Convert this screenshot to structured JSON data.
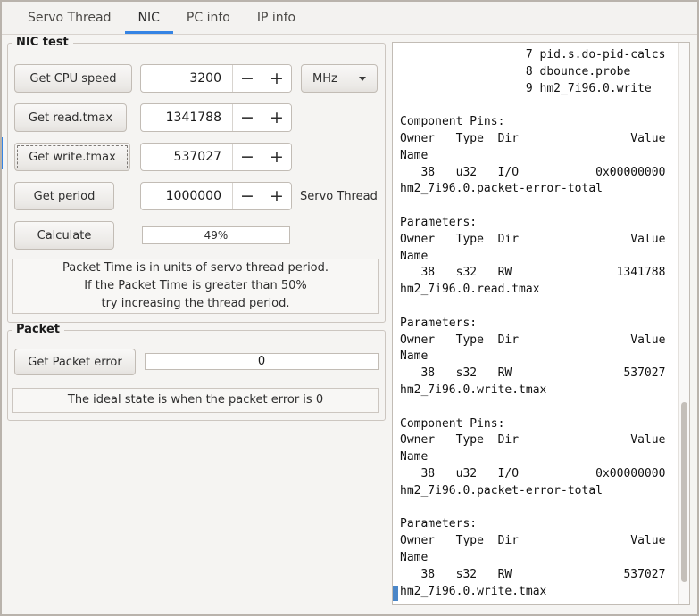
{
  "colors": {
    "accent": "#3584e4"
  },
  "tabs": {
    "items": [
      {
        "label": "Servo Thread"
      },
      {
        "label": "NIC"
      },
      {
        "label": "PC info"
      },
      {
        "label": "IP info"
      }
    ],
    "active": "NIC"
  },
  "nic": {
    "title": "NIC test",
    "spin_minus": "−",
    "spin_plus": "+",
    "rows": [
      {
        "button": "Get CPU speed",
        "value": "3200"
      },
      {
        "button": "Get read.tmax",
        "value": "1341788"
      },
      {
        "button": "Get write.tmax",
        "value": "537027"
      },
      {
        "button": "Get period",
        "value": "1000000"
      }
    ],
    "unit": {
      "selected": "MHz"
    },
    "period_label": "Servo Thread",
    "calculate": "Calculate",
    "progress": "49%",
    "note": [
      "Packet Time is in units of servo thread period.",
      "If the Packet Time is greater than 50%",
      "try increasing the thread period."
    ]
  },
  "packet": {
    "title": "Packet",
    "button": "Get Packet error",
    "value": "0",
    "note": "The ideal state is when the packet error is 0"
  },
  "terminal": {
    "lines": [
      "                  7 pid.s.do-pid-calcs",
      "                  8 dbounce.probe",
      "                  9 hm2_7i96.0.write",
      "",
      "Component Pins:",
      "Owner   Type  Dir                Value",
      "Name",
      "   38   u32   I/O           0x00000000",
      "hm2_7i96.0.packet-error-total",
      "",
      "Parameters:",
      "Owner   Type  Dir                Value",
      "Name",
      "   38   s32   RW               1341788",
      "hm2_7i96.0.read.tmax",
      "",
      "Parameters:",
      "Owner   Type  Dir                Value",
      "Name",
      "   38   s32   RW                537027",
      "hm2_7i96.0.write.tmax",
      "",
      "Component Pins:",
      "Owner   Type  Dir                Value",
      "Name",
      "   38   u32   I/O           0x00000000",
      "hm2_7i96.0.packet-error-total",
      "",
      "Parameters:",
      "Owner   Type  Dir                Value",
      "Name",
      "   38   s32   RW                537027",
      "hm2_7i96.0.write.tmax"
    ]
  }
}
